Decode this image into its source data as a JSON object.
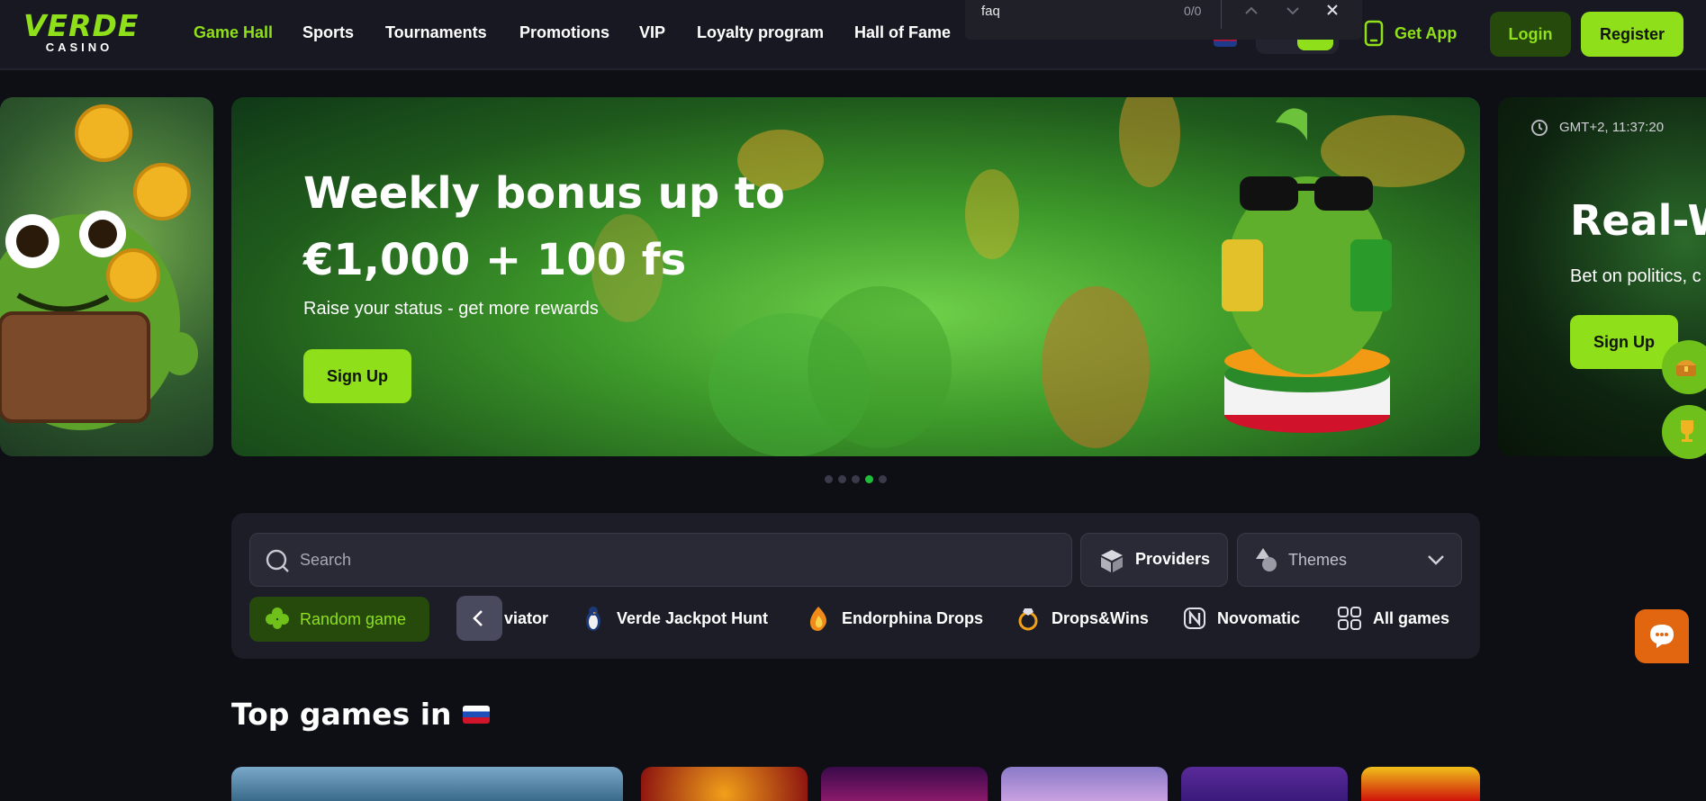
{
  "findbar": {
    "query": "faq",
    "count": "0/0"
  },
  "header": {
    "logo_main": "VERDE",
    "logo_sub": "CASINO",
    "nav": [
      "Game Hall",
      "Sports",
      "Tournaments",
      "Promotions",
      "VIP",
      "Loyalty program",
      "Hall of Fame"
    ],
    "get_app": "Get App",
    "login": "Login",
    "register": "Register"
  },
  "hero": {
    "title_line1": "Weekly bonus up to",
    "title_line2": "€1,000 + 100 fs",
    "subtitle": "Raise your status - get more rewards",
    "cta": "Sign Up"
  },
  "next_banner": {
    "time": "GMT+2,  11:37:20",
    "title": "Real-W",
    "subtitle": "Bet on politics, c",
    "cta": "Sign Up"
  },
  "carousel": {
    "dots": 5,
    "active": 3
  },
  "search": {
    "placeholder": "Search",
    "providers": "Providers",
    "themes": "Themes"
  },
  "categories": [
    "Random game",
    "viator",
    "Verde Jackpot Hunt",
    "Endorphina Drops",
    "Drops&Wins",
    "Novomatic",
    "All games"
  ],
  "section": {
    "title": "Top games in"
  },
  "colors": {
    "brand": "#8fe01a",
    "bg": "#0e0e15",
    "header": "#181822",
    "chat": "#e2660f"
  }
}
